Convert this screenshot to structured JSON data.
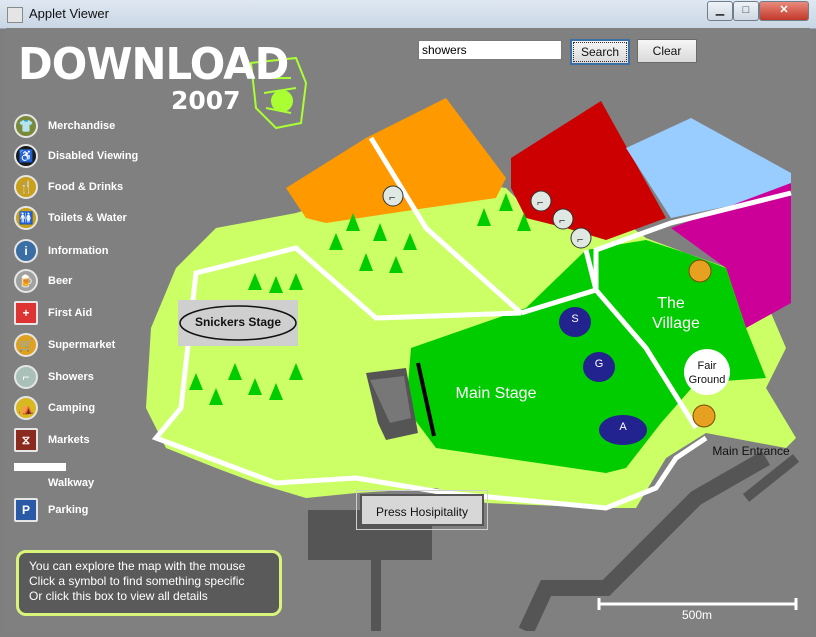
{
  "window": {
    "title": "Applet Viewer",
    "minimize_icon": "minimize-icon",
    "maximize_icon": "maximize-icon",
    "close_icon": "close-icon"
  },
  "brand": {
    "logo_text": "DOWNLOAD",
    "year": "2007",
    "logo_color": "#ffffff",
    "mascot_color": "#aaff33"
  },
  "search": {
    "value": "showers",
    "search_label": "Search",
    "clear_label": "Clear"
  },
  "legend": [
    {
      "label": "Merchandise",
      "icon": "tshirt-icon",
      "color": "#7a8a3a"
    },
    {
      "label": "Disabled Viewing",
      "icon": "wheelchair-icon",
      "color": "#1a1a1a"
    },
    {
      "label": "Food & Drinks",
      "icon": "food-icon",
      "color": "#c9a019"
    },
    {
      "label": "Toilets & Water",
      "icon": "toilet-icon",
      "color": "#c9a019"
    },
    {
      "label": "Information",
      "icon": "info-icon",
      "color": "#3a6ea5"
    },
    {
      "label": "Beer",
      "icon": "beer-icon",
      "color": "#a0a0a0"
    },
    {
      "label": "First Aid",
      "icon": "first-aid-icon",
      "color": "#d33"
    },
    {
      "label": "Supermarket",
      "icon": "cart-icon",
      "color": "#e0a020"
    },
    {
      "label": "Showers",
      "icon": "shower-icon",
      "color": "#a8c0b8"
    },
    {
      "label": "Camping",
      "icon": "tent-icon",
      "color": "#d8b820"
    },
    {
      "label": "Markets",
      "icon": "market-icon",
      "color": "#8b2a1e"
    },
    {
      "label": "Walkway",
      "icon": "walkway-icon",
      "color": "#ffffff"
    },
    {
      "label": "Parking",
      "icon": "parking-icon",
      "color": "#2a5aa5"
    }
  ],
  "map": {
    "snickers_stage": "Snickers Stage",
    "main_stage": "Main Stage",
    "village_line1": "The",
    "village_line2": "Village",
    "fair_line1": "Fair",
    "fair_line2": "Ground",
    "main_entrance": "Main Entrance",
    "press": "Press Hosipitality",
    "markers": [
      "S",
      "G",
      "A"
    ],
    "scale": "500m",
    "colors": {
      "light_green": "#ccff66",
      "main_green": "#00cc00",
      "orange": "#ff9900",
      "red": "#cc0000",
      "sky": "#99ccff",
      "magenta": "#cc0099"
    }
  },
  "info": {
    "line1": "You can explore the map with the mouse",
    "line2": "Click a symbol to find something specific",
    "line3": "Or click this box to view all details"
  }
}
